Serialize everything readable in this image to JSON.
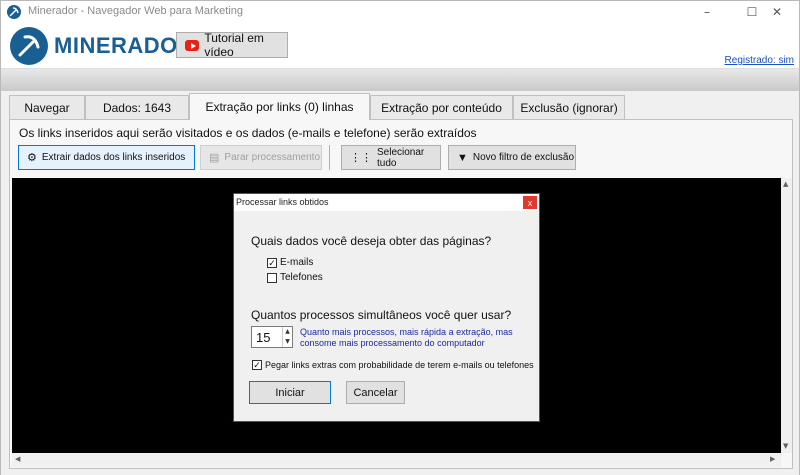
{
  "window": {
    "title": "Minerador - Navegador Web para Marketing",
    "minimize": "–",
    "maximize": "☐",
    "close": "✕"
  },
  "header": {
    "logo_text": "MINERADOR",
    "tutorial_label": "Tutorial em vídeo",
    "registered_link": "Registrado: sim"
  },
  "tabs": [
    {
      "label": "Navegar",
      "active": false
    },
    {
      "label": "Dados: 1643",
      "active": false
    },
    {
      "label": "Extração por links (0) linhas",
      "active": true
    },
    {
      "label": "Extração por conteúdo",
      "active": false
    },
    {
      "label": "Exclusão (ignorar)",
      "active": false
    }
  ],
  "panel": {
    "description": "Os links inseridos aqui serão visitados e os dados (e-mails e telefone) serão extraídos",
    "buttons": {
      "extract": "Extrair dados dos links inseridos",
      "stop": "Parar processamento",
      "select_all": "Selecionar tudo",
      "filter": "Novo filtro de exclusão"
    }
  },
  "dialog": {
    "title": "Processar links obtidos",
    "close": "x",
    "question_data": "Quais dados você deseja obter das páginas?",
    "options": [
      {
        "label": "E-mails",
        "checked": true
      },
      {
        "label": "Telefones",
        "checked": false
      }
    ],
    "question_processes": "Quantos processos simultâneos você quer usar?",
    "processes_value": "15",
    "processes_hint": "Quanto mais processos, mais rápida a extração, mas consome mais processamento do computador",
    "extra_links_label": "Pegar links extras com probabilidade de terem e-mails ou telefones",
    "extra_links_checked": true,
    "start_label": "Iniciar",
    "cancel_label": "Cancelar"
  },
  "colors": {
    "brand": "#1a5f91",
    "link": "#1a4fc2",
    "hint": "#1a2a9e",
    "dialog_border": "#e81123"
  }
}
